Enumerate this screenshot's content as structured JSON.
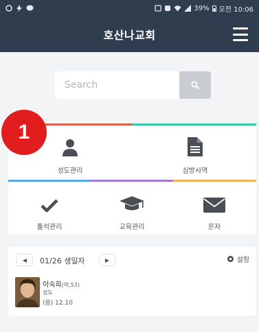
{
  "status_bar": {
    "left_icons": [
      "sync-icon",
      "lightning-icon",
      "chat-bubble-icon"
    ],
    "right_icons": [
      "nfc-icon",
      "alarm-icon",
      "wifi-icon",
      "signal-icon"
    ],
    "battery": "39%",
    "time": "오전 10:06"
  },
  "app_bar": {
    "title": "호산나교회",
    "background": "#2f3d4e"
  },
  "search": {
    "placeholder": "Search"
  },
  "marker": {
    "number": "1"
  },
  "menu": {
    "top_line_colors": [
      "#e05b4a",
      "#3cc6a6"
    ],
    "separator_colors": [
      "#5aa7e6",
      "#a37ad1",
      "#f2b35a"
    ],
    "row1": [
      {
        "label": "성도관리",
        "icon": "person-icon"
      },
      {
        "label": "심방사역",
        "icon": "document-icon"
      }
    ],
    "row2": [
      {
        "label": "출석관리",
        "icon": "checkmark-icon"
      },
      {
        "label": "교육관리",
        "icon": "graduation-cap-icon"
      },
      {
        "label": "문자",
        "icon": "envelope-icon"
      }
    ]
  },
  "birthday": {
    "prev": "◀",
    "next": "▶",
    "label": "01/26 생일자",
    "settings_label": "설정",
    "person": {
      "name": "이숙희",
      "meta": "(여,53)",
      "role": "성도",
      "date": "(음) 12.10"
    }
  }
}
